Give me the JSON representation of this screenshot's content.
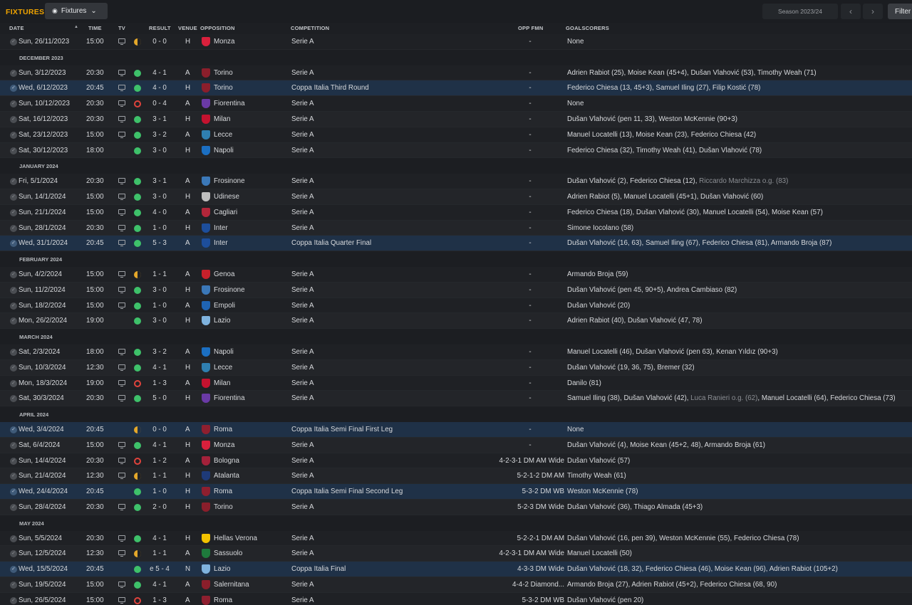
{
  "header": {
    "title": "FIXTURES",
    "view_label": "Fixtures",
    "season_label": "Season 2023/24",
    "filter_label": "Filter"
  },
  "columns": {
    "date": "DATE",
    "time": "TIME",
    "tv": "TV",
    "result": "RESULT",
    "venue": "VENUE",
    "opposition": "OPPOSITION",
    "competition": "COMPETITION",
    "opp_fmn": "OPP FMN",
    "goalscorers": "GOALSCORERS"
  },
  "rows": [
    {
      "kind": "match",
      "date": "Sun, 26/11/2023",
      "time": "15:00",
      "tv": true,
      "outcome": "D",
      "result": "0 - 0",
      "venue": "H",
      "opp": "Monza",
      "badge": "#d9203c",
      "comp": "Serie A",
      "fmn": "-",
      "scorers": [
        {
          "t": "None"
        }
      ],
      "cup": false
    },
    {
      "kind": "month",
      "label": "DECEMBER 2023"
    },
    {
      "kind": "match",
      "date": "Sun, 3/12/2023",
      "time": "20:30",
      "tv": true,
      "outcome": "W",
      "result": "4 - 1",
      "venue": "A",
      "opp": "Torino",
      "badge": "#8b1e2b",
      "comp": "Serie A",
      "fmn": "-",
      "scorers": [
        {
          "t": "Adrien Rabiot (25), Moise Kean (45+4), Dušan Vlahović (53), Timothy Weah (71)"
        }
      ],
      "cup": false
    },
    {
      "kind": "match",
      "date": "Wed, 6/12/2023",
      "time": "20:45",
      "tv": true,
      "outcome": "W",
      "result": "4 - 0",
      "venue": "H",
      "opp": "Torino",
      "badge": "#8b1e2b",
      "comp": "Coppa Italia Third Round",
      "fmn": "-",
      "scorers": [
        {
          "t": "Federico Chiesa (13, 45+3), Samuel Iling (27), Filip Kostić (78)"
        }
      ],
      "cup": true
    },
    {
      "kind": "match",
      "date": "Sun, 10/12/2023",
      "time": "20:30",
      "tv": true,
      "outcome": "L",
      "result": "0 - 4",
      "venue": "A",
      "opp": "Fiorentina",
      "badge": "#6a3aa6",
      "comp": "Serie A",
      "fmn": "-",
      "scorers": [
        {
          "t": "None"
        }
      ],
      "cup": false
    },
    {
      "kind": "match",
      "date": "Sat, 16/12/2023",
      "time": "20:30",
      "tv": true,
      "outcome": "W",
      "result": "3 - 1",
      "venue": "H",
      "opp": "Milan",
      "badge": "#c4122f",
      "comp": "Serie A",
      "fmn": "-",
      "scorers": [
        {
          "t": "Dušan Vlahović (pen 11, 33), Weston McKennie (90+3)"
        }
      ],
      "cup": false
    },
    {
      "kind": "match",
      "date": "Sat, 23/12/2023",
      "time": "15:00",
      "tv": true,
      "outcome": "W",
      "result": "3 - 2",
      "venue": "A",
      "opp": "Lecce",
      "badge": "#2f7fb0",
      "comp": "Serie A",
      "fmn": "-",
      "scorers": [
        {
          "t": "Manuel Locatelli (13), Moise Kean (23), Federico Chiesa (42)"
        }
      ],
      "cup": false
    },
    {
      "kind": "match",
      "date": "Sat, 30/12/2023",
      "time": "18:00",
      "tv": false,
      "outcome": "W",
      "result": "3 - 0",
      "venue": "H",
      "opp": "Napoli",
      "badge": "#1b6fc2",
      "comp": "Serie A",
      "fmn": "-",
      "scorers": [
        {
          "t": "Federico Chiesa (32), Timothy Weah (41), Dušan Vlahović (78)"
        }
      ],
      "cup": false
    },
    {
      "kind": "month",
      "label": "JANUARY 2024"
    },
    {
      "kind": "match",
      "date": "Fri, 5/1/2024",
      "time": "20:30",
      "tv": true,
      "outcome": "W",
      "result": "3 - 1",
      "venue": "A",
      "opp": "Frosinone",
      "badge": "#3b78b8",
      "comp": "Serie A",
      "fmn": "-",
      "scorers": [
        {
          "t": "Dušan Vlahović (2), Federico Chiesa (12), "
        },
        {
          "t": "Riccardo Marchizza o.g. (83)",
          "og": true
        }
      ],
      "cup": false
    },
    {
      "kind": "match",
      "date": "Sun, 14/1/2024",
      "time": "15:00",
      "tv": true,
      "outcome": "W",
      "result": "3 - 0",
      "venue": "H",
      "opp": "Udinese",
      "badge": "#bfbfbf",
      "comp": "Serie A",
      "fmn": "-",
      "scorers": [
        {
          "t": "Adrien Rabiot (5), Manuel Locatelli (45+1), Dušan Vlahović (60)"
        }
      ],
      "cup": false
    },
    {
      "kind": "match",
      "date": "Sun, 21/1/2024",
      "time": "15:00",
      "tv": true,
      "outcome": "W",
      "result": "4 - 0",
      "venue": "A",
      "opp": "Cagliari",
      "badge": "#b3263a",
      "comp": "Serie A",
      "fmn": "-",
      "scorers": [
        {
          "t": "Federico Chiesa (18), Dušan Vlahović (30), Manuel Locatelli (54), Moise Kean (57)"
        }
      ],
      "cup": false
    },
    {
      "kind": "match",
      "date": "Sun, 28/1/2024",
      "time": "20:30",
      "tv": true,
      "outcome": "W",
      "result": "1 - 0",
      "venue": "H",
      "opp": "Inter",
      "badge": "#1d4e9b",
      "comp": "Serie A",
      "fmn": "-",
      "scorers": [
        {
          "t": "Simone Iocolano (58)"
        }
      ],
      "cup": false
    },
    {
      "kind": "match",
      "date": "Wed, 31/1/2024",
      "time": "20:45",
      "tv": true,
      "outcome": "W",
      "result": "5 - 3",
      "venue": "A",
      "opp": "Inter",
      "badge": "#1d4e9b",
      "comp": "Coppa Italia Quarter Final",
      "fmn": "-",
      "scorers": [
        {
          "t": "Dušan Vlahović (16, 63), Samuel Iling (67), Federico Chiesa (81), Armando Broja (87)"
        }
      ],
      "cup": true
    },
    {
      "kind": "month",
      "label": "FEBRUARY 2024"
    },
    {
      "kind": "match",
      "date": "Sun, 4/2/2024",
      "time": "15:00",
      "tv": true,
      "outcome": "D",
      "result": "1 - 1",
      "venue": "A",
      "opp": "Genoa",
      "badge": "#c8202b",
      "comp": "Serie A",
      "fmn": "-",
      "scorers": [
        {
          "t": "Armando Broja (59)"
        }
      ],
      "cup": false
    },
    {
      "kind": "match",
      "date": "Sun, 11/2/2024",
      "time": "15:00",
      "tv": true,
      "outcome": "W",
      "result": "3 - 0",
      "venue": "H",
      "opp": "Frosinone",
      "badge": "#3b78b8",
      "comp": "Serie A",
      "fmn": "-",
      "scorers": [
        {
          "t": "Dušan Vlahović (pen 45, 90+5), Andrea Cambiaso (82)"
        }
      ],
      "cup": false
    },
    {
      "kind": "match",
      "date": "Sun, 18/2/2024",
      "time": "15:00",
      "tv": true,
      "outcome": "W",
      "result": "1 - 0",
      "venue": "A",
      "opp": "Empoli",
      "badge": "#1f64b3",
      "comp": "Serie A",
      "fmn": "-",
      "scorers": [
        {
          "t": "Dušan Vlahović (20)"
        }
      ],
      "cup": false
    },
    {
      "kind": "match",
      "date": "Mon, 26/2/2024",
      "time": "19:00",
      "tv": false,
      "outcome": "W",
      "result": "3 - 0",
      "venue": "H",
      "opp": "Lazio",
      "badge": "#7fb3de",
      "comp": "Serie A",
      "fmn": "-",
      "scorers": [
        {
          "t": "Adrien Rabiot (40), Dušan Vlahović (47, 78)"
        }
      ],
      "cup": false
    },
    {
      "kind": "month",
      "label": "MARCH 2024"
    },
    {
      "kind": "match",
      "date": "Sat, 2/3/2024",
      "time": "18:00",
      "tv": true,
      "outcome": "W",
      "result": "3 - 2",
      "venue": "A",
      "opp": "Napoli",
      "badge": "#1b6fc2",
      "comp": "Serie A",
      "fmn": "-",
      "scorers": [
        {
          "t": "Manuel Locatelli (46), Dušan Vlahović (pen 63), Kenan Yıldız (90+3)"
        }
      ],
      "cup": false
    },
    {
      "kind": "match",
      "date": "Sun, 10/3/2024",
      "time": "12:30",
      "tv": true,
      "outcome": "W",
      "result": "4 - 1",
      "venue": "H",
      "opp": "Lecce",
      "badge": "#2f7fb0",
      "comp": "Serie A",
      "fmn": "-",
      "scorers": [
        {
          "t": "Dušan Vlahović (19, 36, 75), Bremer (32)"
        }
      ],
      "cup": false
    },
    {
      "kind": "match",
      "date": "Mon, 18/3/2024",
      "time": "19:00",
      "tv": true,
      "outcome": "L",
      "result": "1 - 3",
      "venue": "A",
      "opp": "Milan",
      "badge": "#c4122f",
      "comp": "Serie A",
      "fmn": "-",
      "scorers": [
        {
          "t": "Danilo (81)"
        }
      ],
      "cup": false
    },
    {
      "kind": "match",
      "date": "Sat, 30/3/2024",
      "time": "20:30",
      "tv": true,
      "outcome": "W",
      "result": "5 - 0",
      "venue": "H",
      "opp": "Fiorentina",
      "badge": "#6a3aa6",
      "comp": "Serie A",
      "fmn": "-",
      "scorers": [
        {
          "t": "Samuel Iling (38), Dušan Vlahović (42), "
        },
        {
          "t": "Luca Ranieri o.g. (62)",
          "og": true
        },
        {
          "t": ", Manuel Locatelli (64), Federico Chiesa (73)"
        }
      ],
      "cup": false
    },
    {
      "kind": "month",
      "label": "APRIL 2024"
    },
    {
      "kind": "match",
      "date": "Wed, 3/4/2024",
      "time": "20:45",
      "tv": false,
      "outcome": "D",
      "result": "0 - 0",
      "venue": "A",
      "opp": "Roma",
      "badge": "#8e1f2f",
      "comp": "Coppa Italia Semi Final First Leg",
      "fmn": "-",
      "scorers": [
        {
          "t": "None"
        }
      ],
      "cup": true
    },
    {
      "kind": "match",
      "date": "Sat, 6/4/2024",
      "time": "15:00",
      "tv": true,
      "outcome": "W",
      "result": "4 - 1",
      "venue": "H",
      "opp": "Monza",
      "badge": "#d9203c",
      "comp": "Serie A",
      "fmn": "-",
      "scorers": [
        {
          "t": "Dušan Vlahović (4), Moise Kean (45+2, 48), Armando Broja (61)"
        }
      ],
      "cup": false
    },
    {
      "kind": "match",
      "date": "Sun, 14/4/2024",
      "time": "20:30",
      "tv": true,
      "outcome": "L",
      "result": "1 - 2",
      "venue": "A",
      "opp": "Bologna",
      "badge": "#a3213a",
      "comp": "Serie A",
      "fmn": "4-2-3-1 DM AM Wide",
      "scorers": [
        {
          "t": "Dušan Vlahović (57)"
        }
      ],
      "cup": false
    },
    {
      "kind": "match",
      "date": "Sun, 21/4/2024",
      "time": "12:30",
      "tv": true,
      "outcome": "D",
      "result": "1 - 1",
      "venue": "H",
      "opp": "Atalanta",
      "badge": "#1e3a78",
      "comp": "Serie A",
      "fmn": "5-2-1-2 DM AM",
      "scorers": [
        {
          "t": "Timothy Weah (61)"
        }
      ],
      "cup": false
    },
    {
      "kind": "match",
      "date": "Wed, 24/4/2024",
      "time": "20:45",
      "tv": false,
      "outcome": "W",
      "result": "1 - 0",
      "venue": "H",
      "opp": "Roma",
      "badge": "#8e1f2f",
      "comp": "Coppa Italia Semi Final Second Leg",
      "fmn": "5-3-2 DM WB",
      "scorers": [
        {
          "t": "Weston McKennie (78)"
        }
      ],
      "cup": true
    },
    {
      "kind": "match",
      "date": "Sun, 28/4/2024",
      "time": "20:30",
      "tv": true,
      "outcome": "W",
      "result": "2 - 0",
      "venue": "H",
      "opp": "Torino",
      "badge": "#8b1e2b",
      "comp": "Serie A",
      "fmn": "5-2-3 DM Wide",
      "scorers": [
        {
          "t": "Dušan Vlahović (36), Thiago Almada (45+3)"
        }
      ],
      "cup": false
    },
    {
      "kind": "month",
      "label": "MAY 2024"
    },
    {
      "kind": "match",
      "date": "Sun, 5/5/2024",
      "time": "20:30",
      "tv": true,
      "outcome": "W",
      "result": "4 - 1",
      "venue": "H",
      "opp": "Hellas Verona",
      "badge": "#f2c200",
      "comp": "Serie A",
      "fmn": "5-2-2-1 DM AM",
      "scorers": [
        {
          "t": "Dušan Vlahović (16, pen 39), Weston McKennie (55), Federico Chiesa (78)"
        }
      ],
      "cup": false
    },
    {
      "kind": "match",
      "date": "Sun, 12/5/2024",
      "time": "12:30",
      "tv": true,
      "outcome": "D",
      "result": "1 - 1",
      "venue": "A",
      "opp": "Sassuolo",
      "badge": "#1e7a3c",
      "comp": "Serie A",
      "fmn": "4-2-3-1 DM AM Wide",
      "scorers": [
        {
          "t": "Manuel Locatelli (50)"
        }
      ],
      "cup": false
    },
    {
      "kind": "match",
      "date": "Wed, 15/5/2024",
      "time": "20:45",
      "tv": false,
      "outcome": "W",
      "result": "e 5 - 4",
      "venue": "N",
      "opp": "Lazio",
      "badge": "#7fb3de",
      "comp": "Coppa Italia Final",
      "fmn": "4-3-3 DM Wide",
      "scorers": [
        {
          "t": "Dušan Vlahović (18, 32), Federico Chiesa (46), Moise Kean (96), Adrien Rabiot (105+2)"
        }
      ],
      "cup": true
    },
    {
      "kind": "match",
      "date": "Sun, 19/5/2024",
      "time": "15:00",
      "tv": true,
      "outcome": "W",
      "result": "4 - 1",
      "venue": "A",
      "opp": "Salernitana",
      "badge": "#8b1e2b",
      "comp": "Serie A",
      "fmn": "4-4-2 Diamond...",
      "scorers": [
        {
          "t": "Armando Broja (27), Adrien Rabiot (45+2), Federico Chiesa (68, 90)"
        }
      ],
      "cup": false
    },
    {
      "kind": "match",
      "date": "Sun, 26/5/2024",
      "time": "15:00",
      "tv": true,
      "outcome": "L",
      "result": "1 - 3",
      "venue": "A",
      "opp": "Roma",
      "badge": "#8e1f2f",
      "comp": "Serie A",
      "fmn": "5-3-2 DM WB",
      "scorers": [
        {
          "t": "Dušan Vlahović (pen 20)"
        }
      ],
      "cup": false
    }
  ]
}
